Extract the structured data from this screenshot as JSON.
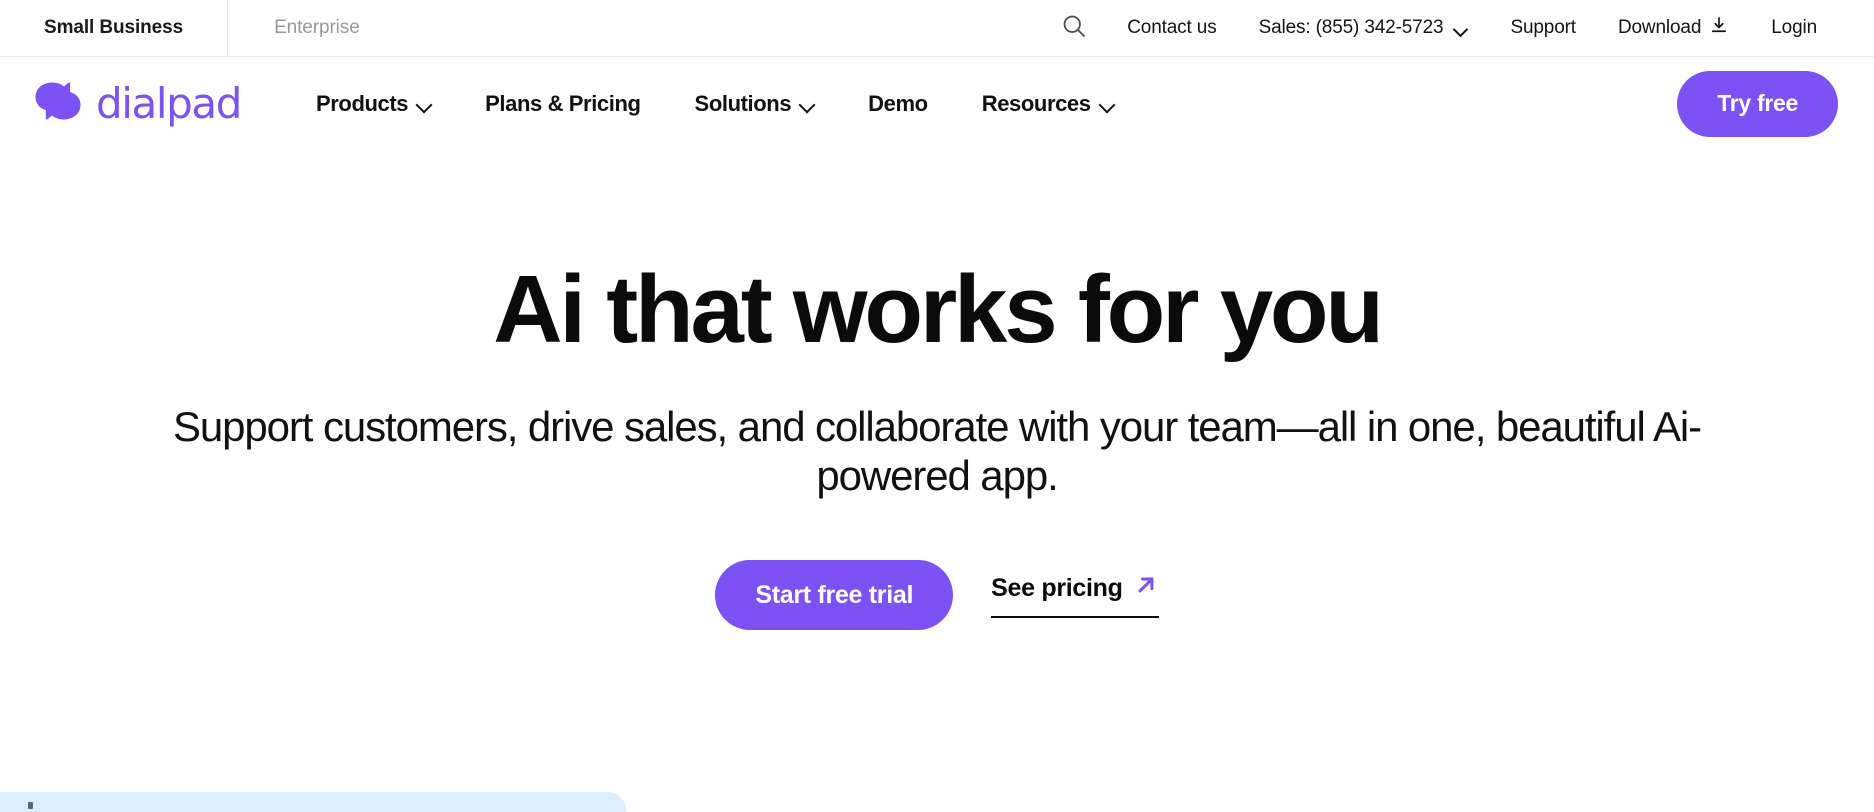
{
  "brand": {
    "name": "dialpad",
    "accent_color": "#7C52F4",
    "logo_icon": "dialpad-logo-mark"
  },
  "utility_bar": {
    "audience_tabs": [
      {
        "label": "Small Business",
        "active": true
      },
      {
        "label": "Enterprise",
        "active": false
      }
    ],
    "search_icon": "search-icon",
    "links": [
      {
        "label": "Contact us",
        "has_caret": false,
        "icon": ""
      },
      {
        "label": "Sales: (855) 342-5723",
        "has_caret": true,
        "icon": "chevron-down-icon"
      },
      {
        "label": "Support",
        "has_caret": false,
        "icon": ""
      },
      {
        "label": "Download",
        "has_caret": false,
        "icon": "download-icon"
      },
      {
        "label": "Login",
        "has_caret": false,
        "icon": ""
      }
    ]
  },
  "main_nav": {
    "items": [
      {
        "label": "Products",
        "has_caret": true
      },
      {
        "label": "Plans & Pricing",
        "has_caret": false
      },
      {
        "label": "Solutions",
        "has_caret": true
      },
      {
        "label": "Demo",
        "has_caret": false
      },
      {
        "label": "Resources",
        "has_caret": true
      }
    ],
    "cta_label": "Try free"
  },
  "hero": {
    "title": "Ai that works for you",
    "subtitle": "Support customers, drive sales, and collaborate with your team—all in one, beautiful Ai-powered app.",
    "primary_cta": "Start free trial",
    "secondary_cta": "See pricing",
    "secondary_cta_icon": "arrow-up-right-icon"
  },
  "bottom_panel": {
    "background_color": "#deedfb"
  }
}
